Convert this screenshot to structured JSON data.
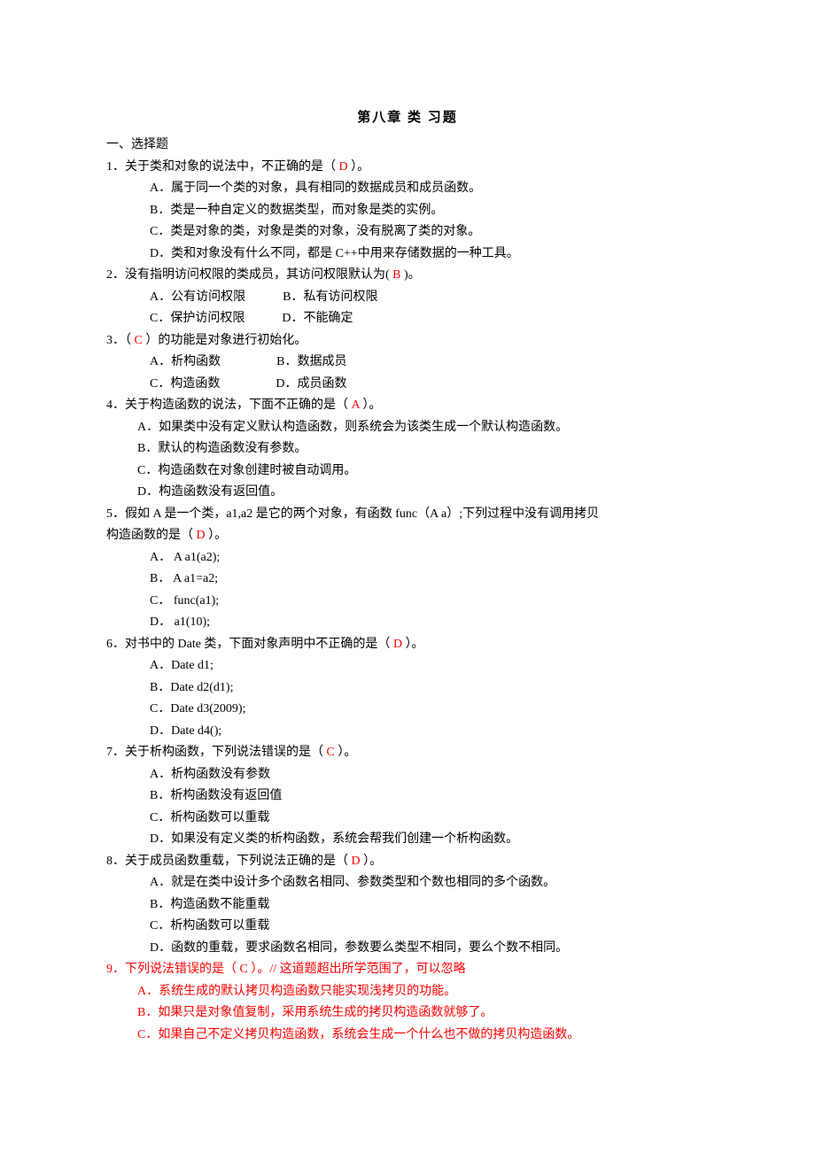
{
  "title": "第八章   类  习题",
  "section": "一、选择题",
  "q1": {
    "stem_a": "1．关于类和对象的说法中，不正确的是（   ",
    "ans": "D",
    "stem_b": "      ）。",
    "a": "A．属于同一个类的对象，具有相同的数据成员和成员函数。",
    "b": "B．类是一种自定义的数据类型，而对象是类的实例。",
    "c": "C．类是对象的类，对象是类的对象，没有脱离了类的对象。",
    "d": "D．类和对象没有什么不同，都是 C++中用来存储数据的一种工具。"
  },
  "q2": {
    "stem_a": "2．没有指明访问权限的类成员，其访问权限默认为(    ",
    "ans": "B",
    "stem_b": "    )。",
    "row1": "A．公有访问权限            B．私有访问权限",
    "row2": "C．保护访问权限            D．不能确定"
  },
  "q3": {
    "stem_a": "3．（   ",
    "ans": "C",
    "stem_b": "   ）的功能是对象进行初始化。",
    "row1": "A．析构函数                  B．数据成员",
    "row2": "C．构造函数                  D．成员函数"
  },
  "q4": {
    "stem_a": "4．关于构造函数的说法，下面不正确的是（    ",
    "ans": "A",
    "stem_b": "   ）。",
    "a": "A．如果类中没有定义默认构造函数，则系统会为该类生成一个默认构造函数。",
    "b": "B．默认的构造函数没有参数。",
    "c": "C．构造函数在对象创建时被自动调用。",
    "d": "D．构造函数没有返回值。"
  },
  "q5": {
    "line1": "5．假如 A 是一个类，a1,a2 是它的两个对象，有函数 func（A a）;下列过程中没有调用拷贝",
    "line2a": "构造函数的是（    ",
    "ans": "D",
    "line2b": "    ）。",
    "a": "A．   A    a1(a2);",
    "b": "B．   A    a1=a2;",
    "c": "C．   func(a1);",
    "d": "D．   a1(10);"
  },
  "q6": {
    "stem_a": "6．对书中的 Date 类，下面对象声明中不正确的是（    ",
    "ans": "D",
    "stem_b": "    ）。",
    "a": "A．Date d1;",
    "b": "B．Date d2(d1);",
    "c": "C．Date d3(2009);",
    "d": "D．Date d4();"
  },
  "q7": {
    "stem_a": "7．关于析构函数，下列说法错误的是（    ",
    "ans": "C",
    "stem_b": "   ）。",
    "a": "A．析构函数没有参数",
    "b": "B．析构函数没有返回值",
    "c": "C．析构函数可以重载",
    "d": "D．如果没有定义类的析构函数，系统会帮我们创建一个析构函数。"
  },
  "q8": {
    "stem_a": "8．关于成员函数重载，下列说法正确的是（   ",
    "ans": "D",
    "stem_b": "    ）。",
    "a": "A．就是在类中设计多个函数名相同、参数类型和个数也相同的多个函数。",
    "b": "B．构造函数不能重载",
    "c": "C．析构函数可以重载",
    "d": "D．函数的重载，要求函数名相同，参数要么类型不相同，要么个数不相同。"
  },
  "q9": {
    "stem_a": "9．下列说法错误的是（       ",
    "ans": "C",
    "stem_b": "       ）。// 这道题超出所学范围了，可以忽略",
    "a": "A．系统生成的默认拷贝构造函数只能实现浅拷贝的功能。",
    "b": "B．如果只是对象值复制，采用系统生成的拷贝构造函数就够了。",
    "c": "C．如果自己不定义拷贝构造函数，系统会生成一个什么也不做的拷贝构造函数。"
  }
}
